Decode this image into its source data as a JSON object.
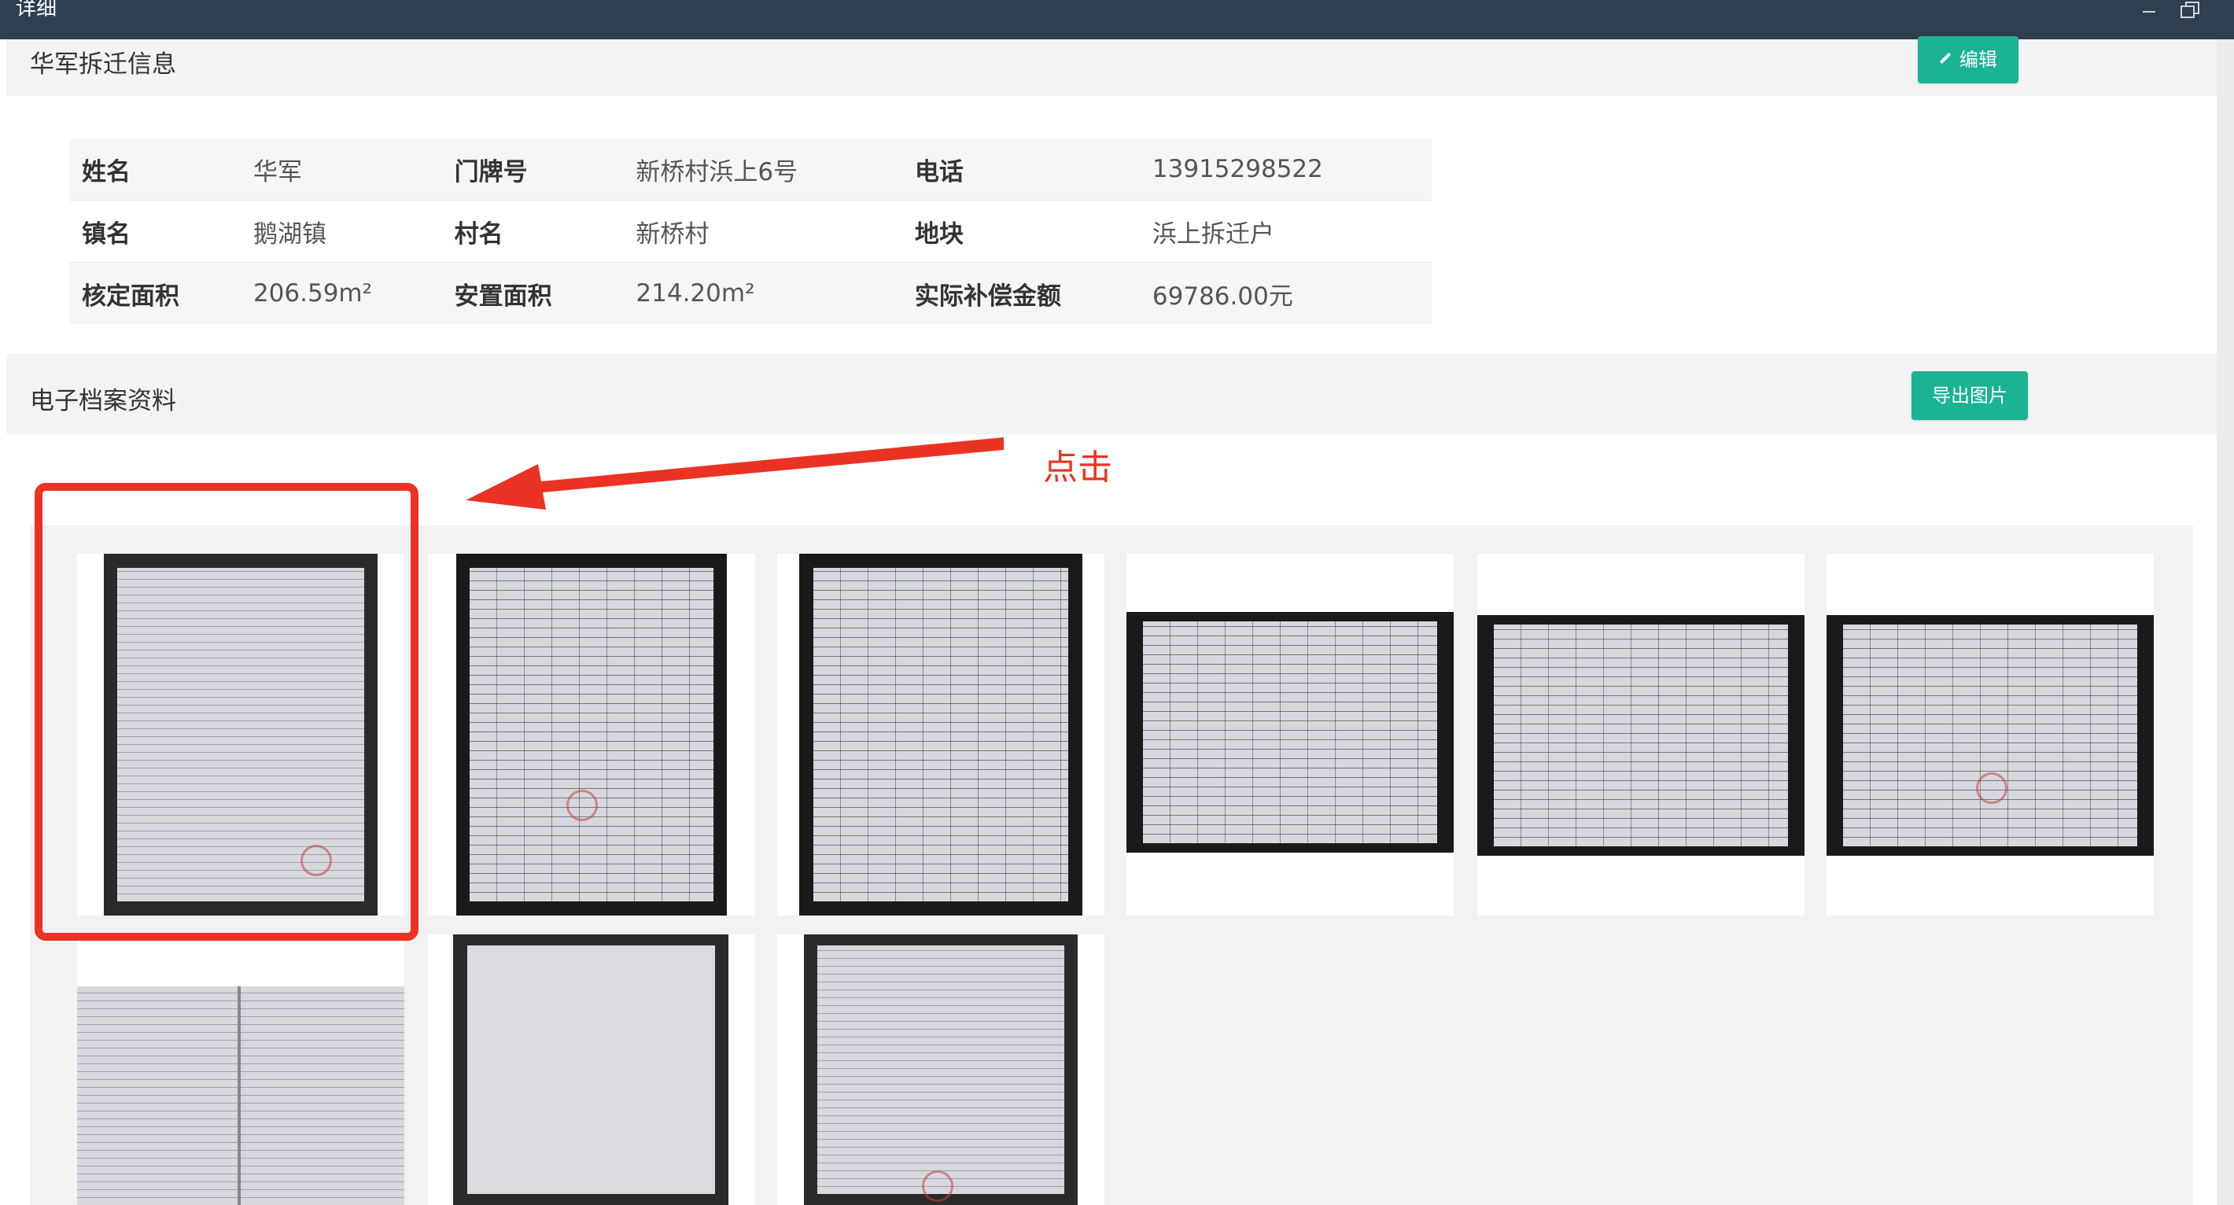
{
  "window": {
    "title": "详细"
  },
  "info_section": {
    "title": "华军拆迁信息",
    "edit_button": "编辑",
    "rows": [
      [
        {
          "label": "姓名",
          "value": "华军"
        },
        {
          "label": "门牌号",
          "value": "新桥村浜上6号"
        },
        {
          "label": "电话",
          "value": "13915298522"
        }
      ],
      [
        {
          "label": "镇名",
          "value": "鹅湖镇"
        },
        {
          "label": "村名",
          "value": "新桥村"
        },
        {
          "label": "地块",
          "value": "浜上拆迁户"
        }
      ],
      [
        {
          "label": "核定面积",
          "value": "206.59m²"
        },
        {
          "label": "安置面积",
          "value": "214.20m²"
        },
        {
          "label": "实际补偿金额",
          "value": "69786.00元"
        }
      ]
    ]
  },
  "archive_section": {
    "title": "电子档案资料",
    "export_button": "导出图片"
  },
  "annotation": {
    "click_label": "点击",
    "color": "#ea3323"
  },
  "colors": {
    "titlebar": "#2f3f50",
    "accent_green": "#1ab394"
  }
}
